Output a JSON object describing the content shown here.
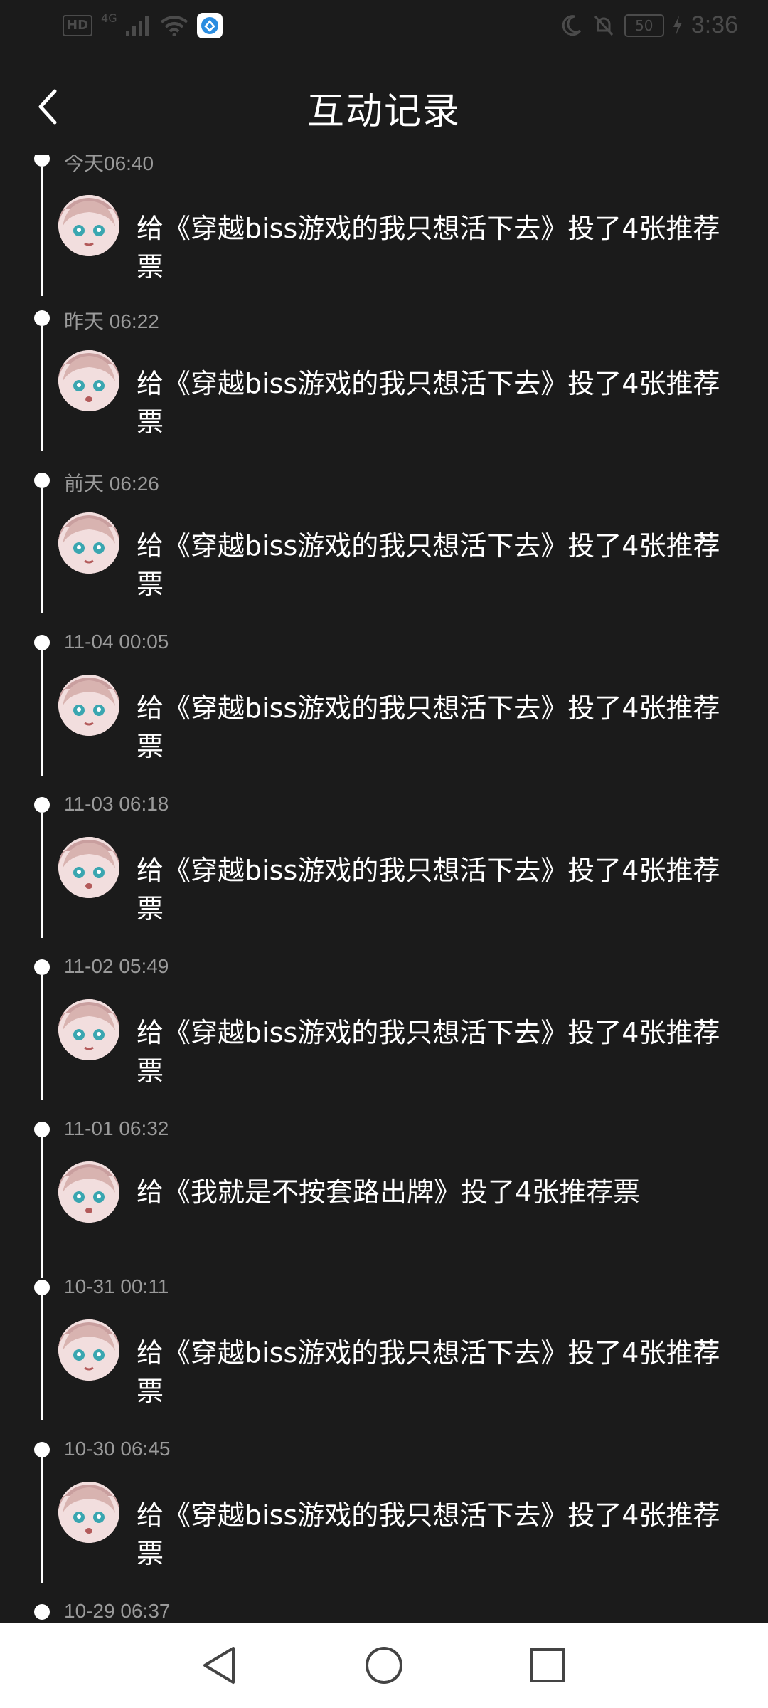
{
  "status_bar": {
    "hd": "HD",
    "network": "4G",
    "battery": "50",
    "time": "3:36"
  },
  "header": {
    "title": "互动记录"
  },
  "records": [
    {
      "time": "今天06:40",
      "text": "给《穿越biss游戏的我只想活下去》投了4张推荐票"
    },
    {
      "time": "昨天 06:22",
      "text": "给《穿越biss游戏的我只想活下去》投了4张推荐票"
    },
    {
      "time": "前天 06:26",
      "text": "给《穿越biss游戏的我只想活下去》投了4张推荐票"
    },
    {
      "time": "11-04 00:05",
      "text": "给《穿越biss游戏的我只想活下去》投了4张推荐票"
    },
    {
      "time": "11-03 06:18",
      "text": "给《穿越biss游戏的我只想活下去》投了4张推荐票"
    },
    {
      "time": "11-02 05:49",
      "text": "给《穿越biss游戏的我只想活下去》投了4张推荐票"
    },
    {
      "time": "11-01 06:32",
      "text": "给《我就是不按套路出牌》投了4张推荐票"
    },
    {
      "time": "10-31 00:11",
      "text": "给《穿越biss游戏的我只想活下去》投了4张推荐票"
    },
    {
      "time": "10-30 06:45",
      "text": "给《穿越biss游戏的我只想活下去》投了4张推荐票"
    },
    {
      "time": "10-29 06:37",
      "text": ""
    }
  ],
  "icons": {
    "back": "chevron-left-icon",
    "nav_back": "triangle-back-icon",
    "nav_home": "circle-home-icon",
    "nav_recents": "square-recents-icon"
  },
  "colors": {
    "background": "#1b1b1b",
    "text": "#ffffff",
    "timestamp": "#9a9a9a",
    "nav_bar": "#ffffff"
  }
}
